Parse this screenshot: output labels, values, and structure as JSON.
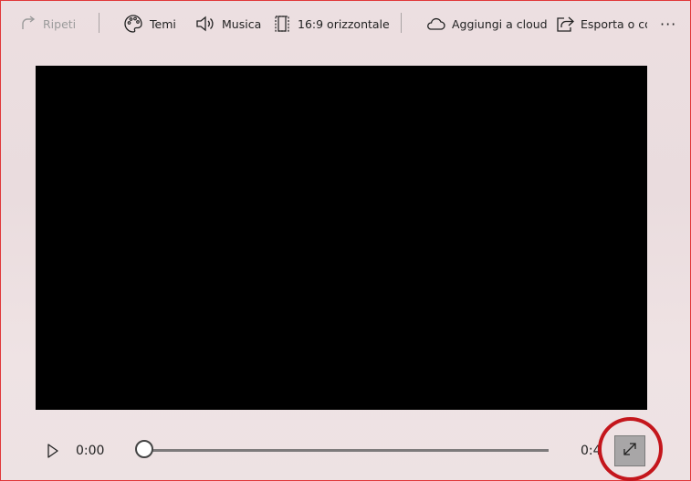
{
  "toolbar": {
    "repeat_label": "Ripeti",
    "themes_label": "Temi",
    "music_label": "Musica",
    "aspect_label": "16:9 orizzontale",
    "cloud_label": "Aggiungi a cloud",
    "export_label": "Esporta o condividi",
    "more_label": "···"
  },
  "player": {
    "current_time": "0:00",
    "end_time": "0:4",
    "progress": 0
  },
  "colors": {
    "highlight_ring": "#c4161c",
    "video_bg": "#000000"
  }
}
